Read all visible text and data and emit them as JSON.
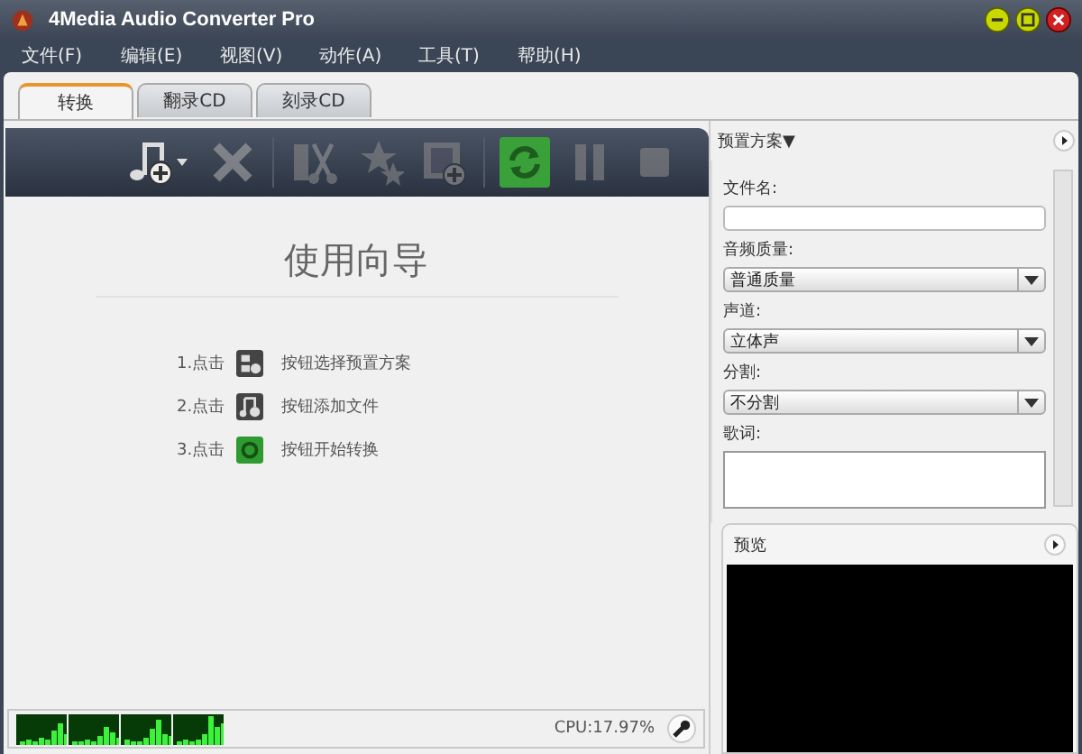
{
  "window": {
    "title": "4Media Audio Converter Pro"
  },
  "menu": [
    "文件(F)",
    "编辑(E)",
    "视图(V)",
    "动作(A)",
    "工具(T)",
    "帮助(H)"
  ],
  "tabs": [
    {
      "label": "转换",
      "selected": true
    },
    {
      "label": "翻录CD",
      "selected": false
    },
    {
      "label": "刻录CD",
      "selected": false
    }
  ],
  "toolbar": [
    {
      "kind": "add",
      "disabled": false
    },
    {
      "kind": "delete",
      "disabled": true
    },
    {
      "kind": "sep"
    },
    {
      "kind": "cut",
      "disabled": true
    },
    {
      "kind": "effects",
      "disabled": true
    },
    {
      "kind": "merge",
      "disabled": true
    },
    {
      "kind": "sep"
    },
    {
      "kind": "convert",
      "disabled": false
    },
    {
      "kind": "pause",
      "disabled": true
    },
    {
      "kind": "stop",
      "disabled": true
    }
  ],
  "guide": {
    "title": "使用向导",
    "steps": [
      {
        "number": "1.点击",
        "kind": "profile",
        "text": "按钮选择预置方案"
      },
      {
        "number": "2.点击",
        "kind": "add",
        "text": "按钮添加文件"
      },
      {
        "number": "3.点击",
        "kind": "convert",
        "text": "按钮开始转换"
      }
    ]
  },
  "status_bar": {
    "cpu": "CPU:17.97%"
  },
  "profile_panel": {
    "title": "预置方案▼",
    "fields": [
      {
        "kind": "input",
        "label": "文件名:"
      },
      {
        "kind": "select",
        "label": "音频质量:",
        "value": "普通质量"
      },
      {
        "kind": "select",
        "label": "声道:",
        "value": "立体声"
      },
      {
        "kind": "select",
        "label": "分割:",
        "value": "不分割"
      },
      {
        "kind": "textarea",
        "label": "歌词:"
      }
    ]
  },
  "preview": {
    "title": "预览"
  }
}
